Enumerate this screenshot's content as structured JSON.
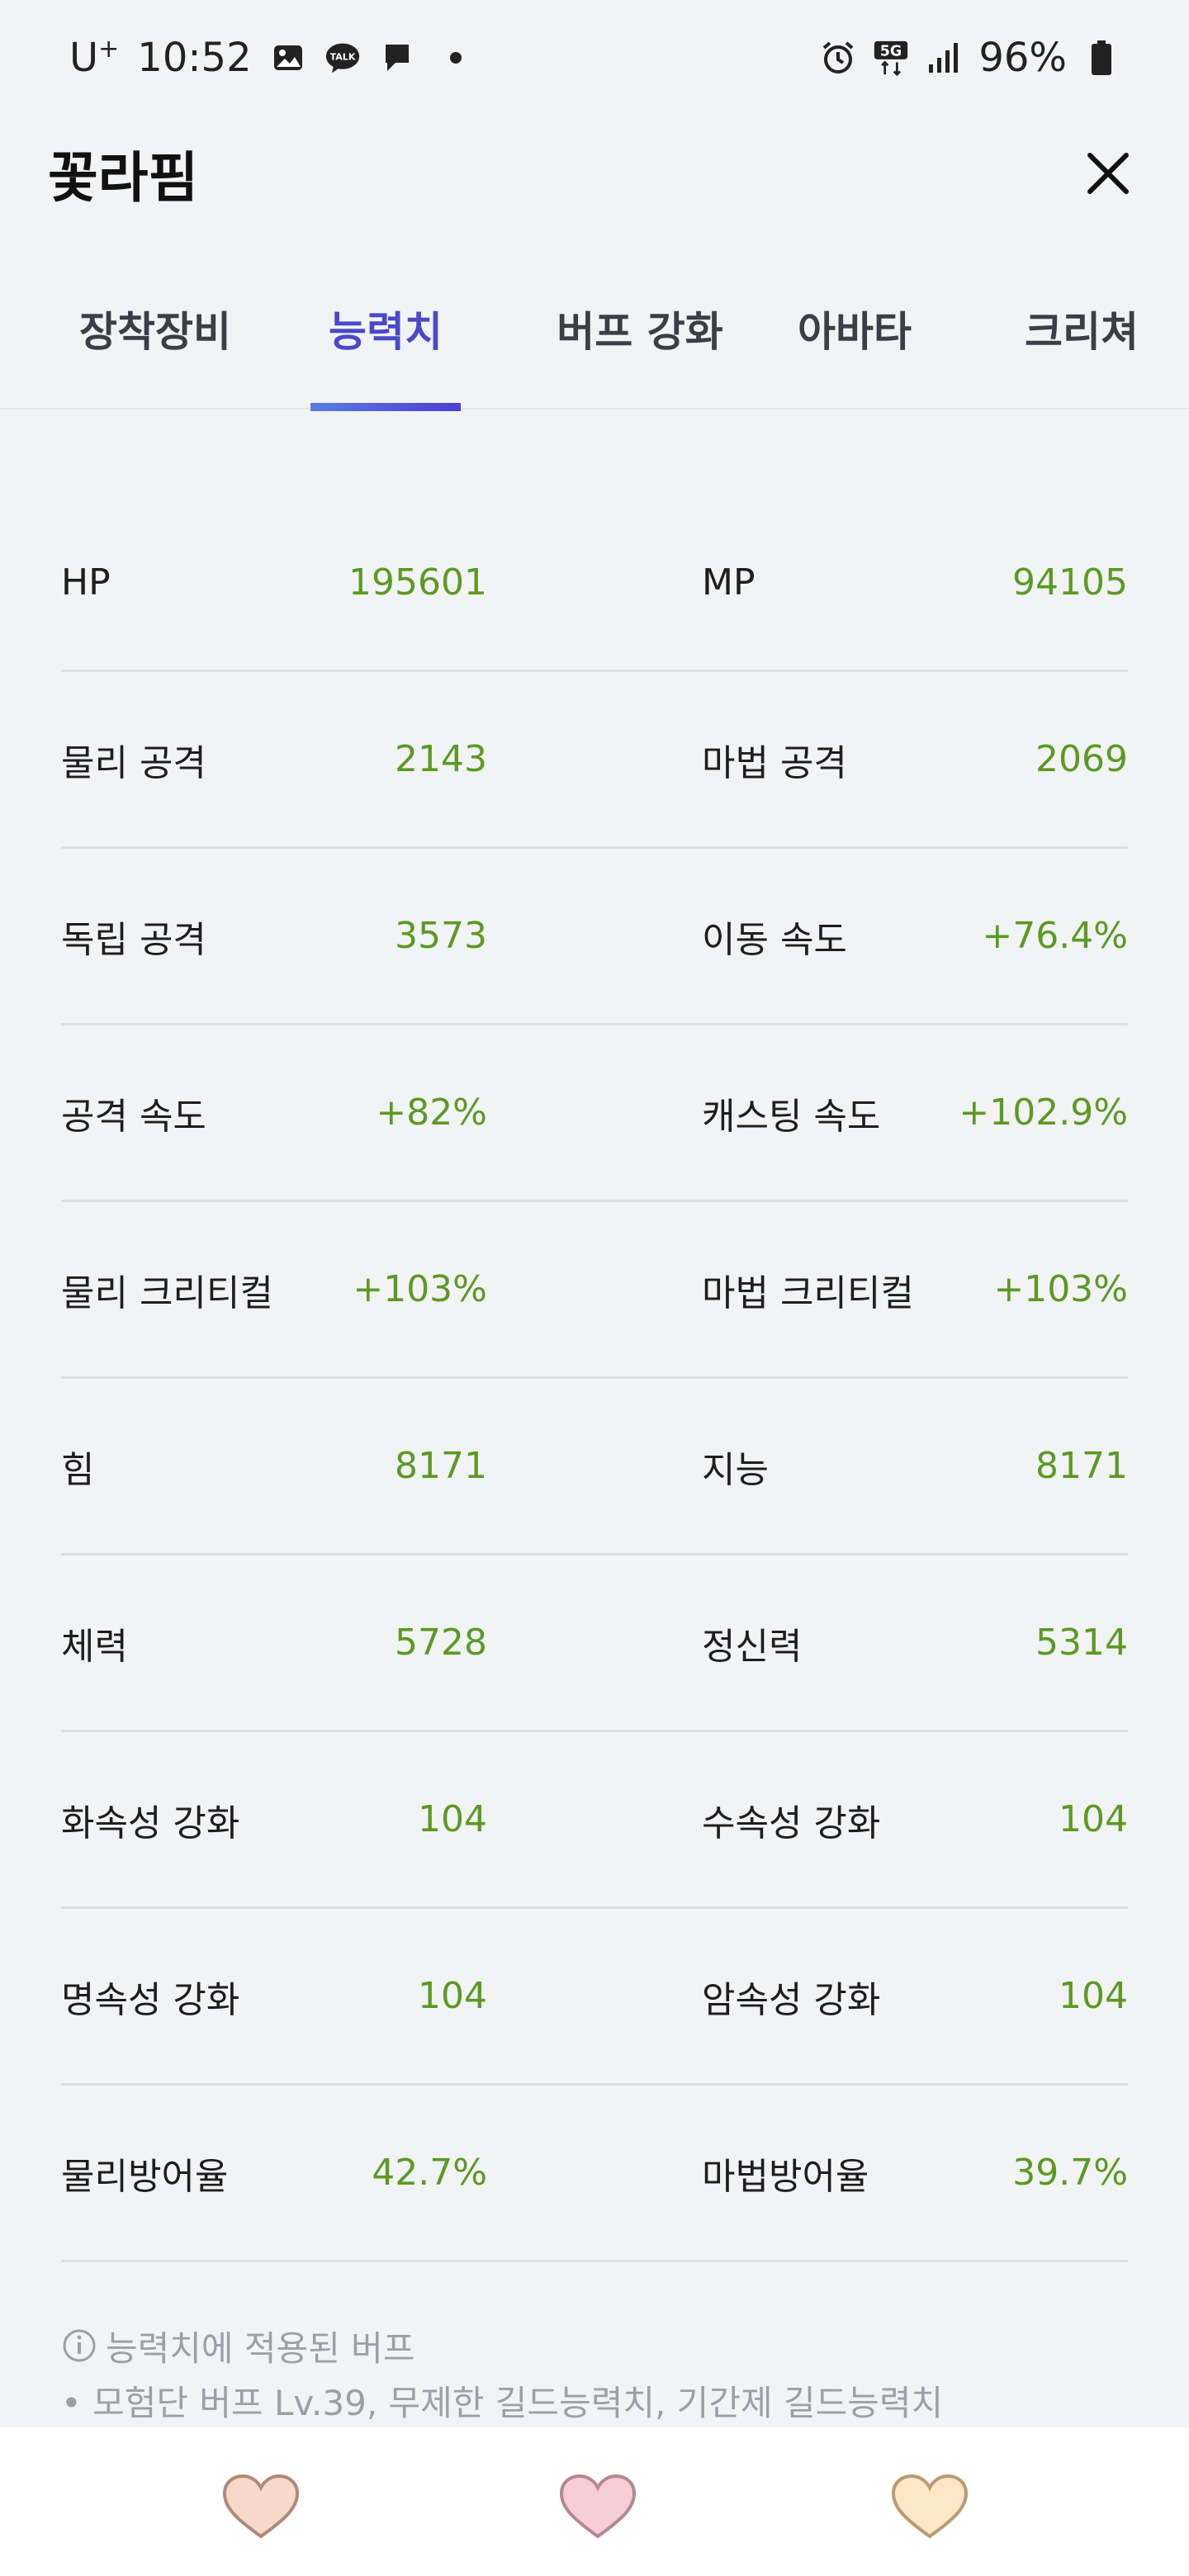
{
  "status_bar": {
    "carrier": "U",
    "carrier_sup": "+",
    "time": "10:52",
    "network": "5G",
    "battery": "96%"
  },
  "header": {
    "title": "꽃라핌"
  },
  "tabs": [
    {
      "label": "장착장비",
      "active": false
    },
    {
      "label": "능력치",
      "active": true
    },
    {
      "label": "버프 강화",
      "active": false
    },
    {
      "label": "아바타",
      "active": false
    },
    {
      "label": "크리쳐",
      "active": false
    }
  ],
  "stats": [
    {
      "left": {
        "label": "HP",
        "value": "195601"
      },
      "right": {
        "label": "MP",
        "value": "94105"
      }
    },
    {
      "left": {
        "label": "물리 공격",
        "value": "2143"
      },
      "right": {
        "label": "마법 공격",
        "value": "2069"
      }
    },
    {
      "left": {
        "label": "독립 공격",
        "value": "3573"
      },
      "right": {
        "label": "이동 속도",
        "value": "+76.4%"
      }
    },
    {
      "left": {
        "label": "공격 속도",
        "value": "+82%"
      },
      "right": {
        "label": "캐스팅 속도",
        "value": "+102.9%"
      }
    },
    {
      "left": {
        "label": "물리 크리티컬",
        "value": "+103%"
      },
      "right": {
        "label": "마법 크리티컬",
        "value": "+103%"
      }
    },
    {
      "left": {
        "label": "힘",
        "value": "8171"
      },
      "right": {
        "label": "지능",
        "value": "8171"
      }
    },
    {
      "left": {
        "label": "체력",
        "value": "5728"
      },
      "right": {
        "label": "정신력",
        "value": "5314"
      }
    },
    {
      "left": {
        "label": "화속성 강화",
        "value": "104"
      },
      "right": {
        "label": "수속성 강화",
        "value": "104"
      }
    },
    {
      "left": {
        "label": "명속성 강화",
        "value": "104"
      },
      "right": {
        "label": "암속성 강화",
        "value": "104"
      }
    },
    {
      "left": {
        "label": "물리방어율",
        "value": "42.7%"
      },
      "right": {
        "label": "마법방어율",
        "value": "39.7%"
      }
    }
  ],
  "buff_note": {
    "title": "능력치에 적용된 버프",
    "detail": "• 모험단 버프 Lv.39, 무제한 길드능력치, 기간제 길드능력치"
  },
  "bottom_bar": {
    "hearts": [
      {
        "icon": "heart-icon",
        "color": "#f6d9c8"
      },
      {
        "icon": "heart-icon",
        "color": "#f7cdd8"
      },
      {
        "icon": "heart-icon",
        "color": "#fbe6c6"
      }
    ]
  },
  "colors": {
    "accent": "#4a49c9",
    "value_green": "#5b9a22",
    "background": "#f2f3f5"
  }
}
